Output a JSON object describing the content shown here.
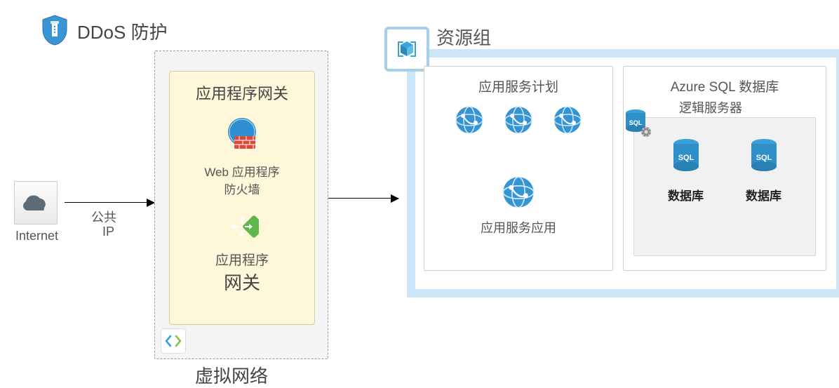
{
  "ddos": {
    "label": "DDoS 防护"
  },
  "internet": {
    "label": "Internet"
  },
  "arrow1": {
    "label1": "公共",
    "label2": "IP"
  },
  "vnet": {
    "label": "虚拟网络"
  },
  "appgw": {
    "title": "应用程序网关",
    "waf1": "Web 应用程序",
    "waf2": "防火墙",
    "gw1": "应用程序",
    "gw2": "网关"
  },
  "resource_group": {
    "title": "资源组",
    "plan": {
      "title": "应用服务计划",
      "app_label": "应用服务应用"
    },
    "sql": {
      "title": "Azure SQL 数据库",
      "logical_label": "逻辑服务器",
      "db_label_1": "数据库",
      "db_label_2": "数据库"
    }
  }
}
